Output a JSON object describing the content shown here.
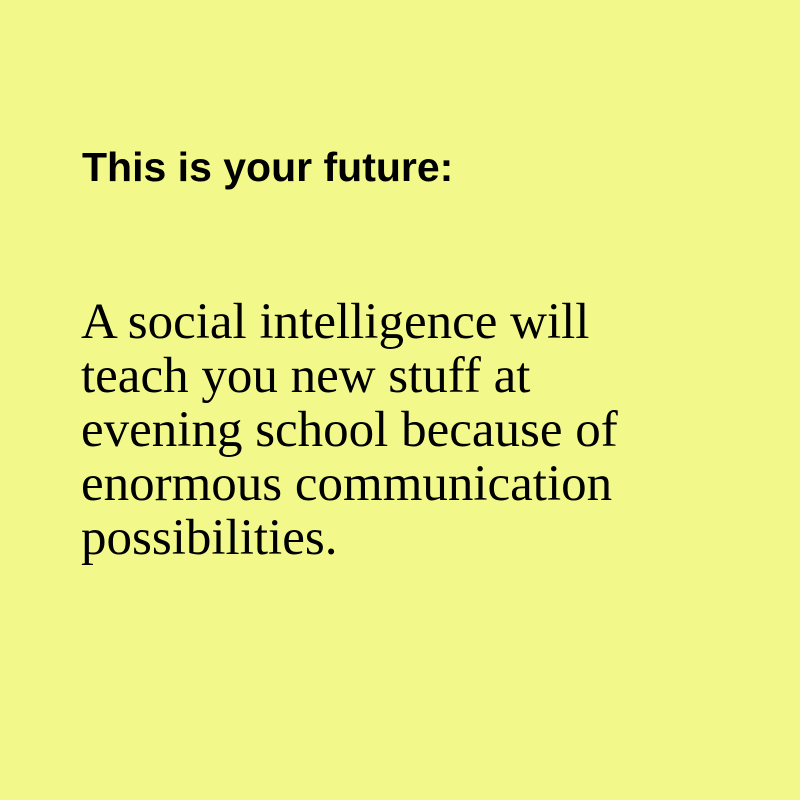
{
  "card": {
    "background": "#f2f98a",
    "heading": "This is your future:",
    "body_lines": [
      "A social intelligence will",
      "teach you new stuff at",
      "evening school because of",
      "enormous communication",
      "possibilities."
    ]
  }
}
